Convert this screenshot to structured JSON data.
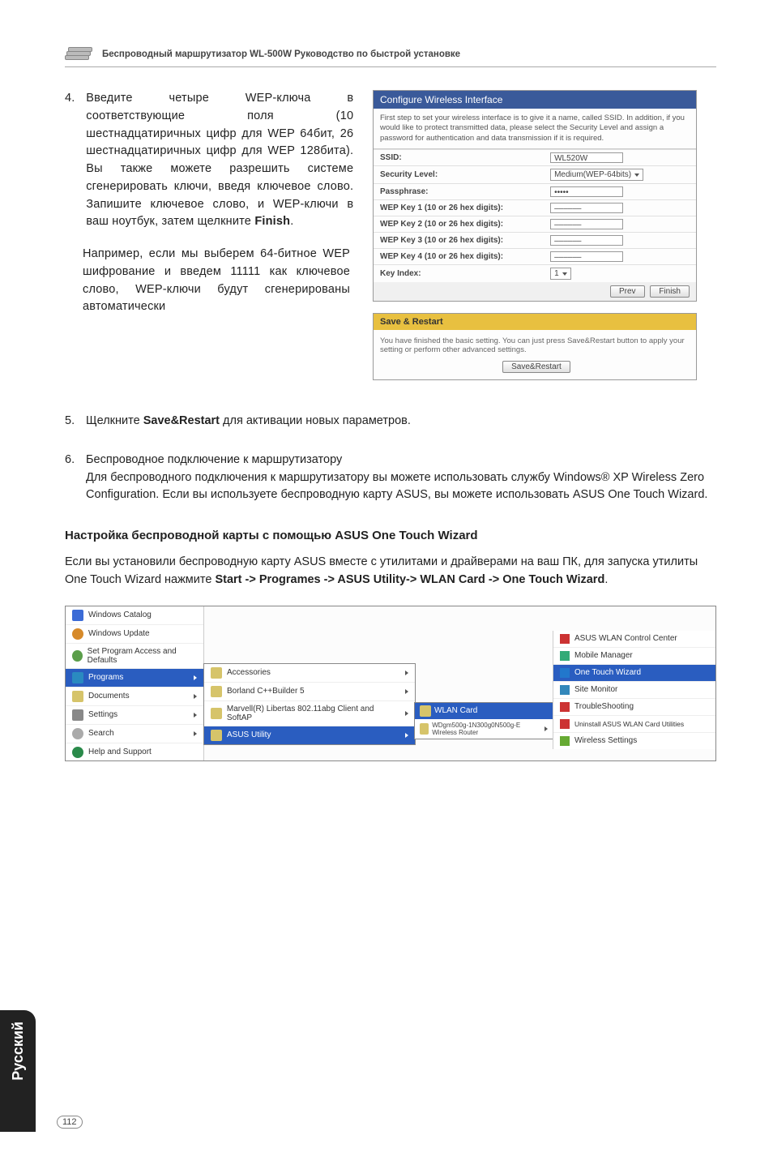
{
  "header": {
    "title": "Беспроводный маршрутизатор WL-500W Руководство по быстрой установке"
  },
  "step4": {
    "num": "4.",
    "body1": "Введите четыре WEP-ключа в соответствующие поля (10 шестнадцатиричных цифр для WEP 64бит, 26 шестнадцатиричных цифр для WEP 128бита). Вы также можете разрешить системе сгенерировать ключи, введя ключевое слово. Запишите  ключевое слово, и WEP-ключи в ваш ноутбук, затем щелкните ",
    "finish": "Finish",
    "body2": "Например, если мы  выберем 64-битное WEP  шифрование и введем 11111 как ключевое слово, WEP-ключи будут сгенерированы автоматически"
  },
  "panel1": {
    "title": "Configure Wireless Interface",
    "note": "First step to set your wireless interface is to give it a name, called SSID. In addition, if you would like to protect transmitted data, please select the Security Level and assign a password for authentication and data transmission if it is required.",
    "rows": {
      "ssid_label": "SSID:",
      "ssid_value": "WL520W",
      "security_label": "Security Level:",
      "security_value": "Medium(WEP-64bits)",
      "passphrase_label": "Passphrase:",
      "passphrase_value": "•••••",
      "wep1_label": "WEP Key 1 (10 or 26 hex digits):",
      "wep1_value": "––––––",
      "wep2_label": "WEP Key 2 (10 or 26 hex digits):",
      "wep2_value": "––––––",
      "wep3_label": "WEP Key 3 (10 or 26 hex digits):",
      "wep3_value": "––––––",
      "wep4_label": "WEP Key 4 (10 or 26 hex digits):",
      "wep4_value": "––––––",
      "keyindex_label": "Key Index:",
      "keyindex_value": "1"
    },
    "buttons": {
      "prev": "Prev",
      "finish": "Finish"
    }
  },
  "panel2": {
    "title": "Save & Restart",
    "body": "You have finished the basic setting. You can just press Save&Restart button to apply your setting or perform other advanced settings.",
    "button": "Save&Restart"
  },
  "step5": {
    "num": "5.",
    "body_pre": "Щелкните  ",
    "bold": "Save&Restart",
    "body_post": " для активации новых параметров."
  },
  "step6": {
    "num": "6.",
    "line1": "Беспроводное подключение к маршрутизатору",
    "line2": "Для беспроводного подключения к маршрутизатору вы можете использовать службу Windows® XP Wireless Zero Configuration.  Если вы используете беспроводную карту ASUS, вы можете использовать ASUS One Touch Wizard."
  },
  "h3": "Настройка беспроводной карты с помощью ASUS One Touch Wizard",
  "para": {
    "pre": "Если вы установили беспроводную карту ASUS вместе с утилитами и драйверами на ваш ПК, для запуска утилиты One Touch Wizard нажмите ",
    "bold": "Start -> Programes -> ASUS Utility-> WLAN Card -> One Touch Wizard",
    "post": "."
  },
  "startmenu": {
    "left": {
      "catalog": "Windows Catalog",
      "update": "Windows Update",
      "defaults": "Set Program Access and Defaults",
      "programs": "Programs",
      "documents": "Documents",
      "settings": "Settings",
      "search": "Search",
      "help": "Help and Support"
    },
    "sub1": {
      "accessories": "Accessories",
      "borland": "Borland C++Builder 5",
      "marvell": "Marvell(R) Libertas 802.11abg Client and SoftAP",
      "asus": "ASUS Utility"
    },
    "sub2": {
      "title": "WLAN Card",
      "row": "WDgm500g-1N300g0N500g-E Wireless Router"
    },
    "right": {
      "r1": "ASUS WLAN Control Center",
      "r2": "Mobile Manager",
      "r3": "One Touch Wizard",
      "r4": "Site Monitor",
      "r5": "TroubleShooting",
      "r6": "Uninstall ASUS WLAN Card Utilities",
      "r7": "Wireless Settings"
    }
  },
  "sideTab": "Русский",
  "pageNum": "112"
}
